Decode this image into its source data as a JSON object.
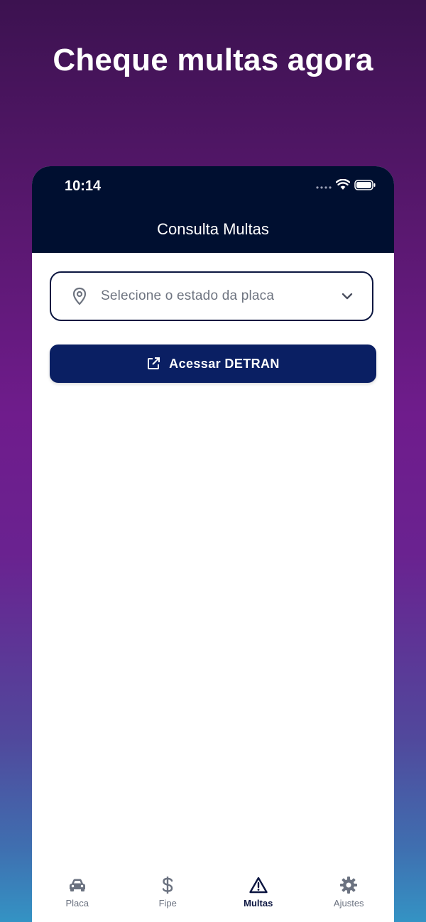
{
  "headline": "Cheque multas agora",
  "status_bar": {
    "time": "10:14"
  },
  "nav": {
    "title": "Consulta Multas"
  },
  "state_select": {
    "placeholder": "Selecione o estado da placa",
    "icon": "map-pin-icon"
  },
  "detran_button": {
    "label": "Acessar DETRAN",
    "icon": "external-link-icon"
  },
  "tabs": [
    {
      "label": "Placa",
      "icon": "car-icon",
      "active": false
    },
    {
      "label": "Fipe",
      "icon": "dollar-icon",
      "active": false
    },
    {
      "label": "Multas",
      "icon": "warning-icon",
      "active": true
    },
    {
      "label": "Ajustes",
      "icon": "gear-icon",
      "active": false
    }
  ],
  "colors": {
    "nav_background": "#000f30",
    "button_background": "#0a1f63",
    "active_tab": "#0b1540",
    "inactive_tab": "#6b7280"
  }
}
